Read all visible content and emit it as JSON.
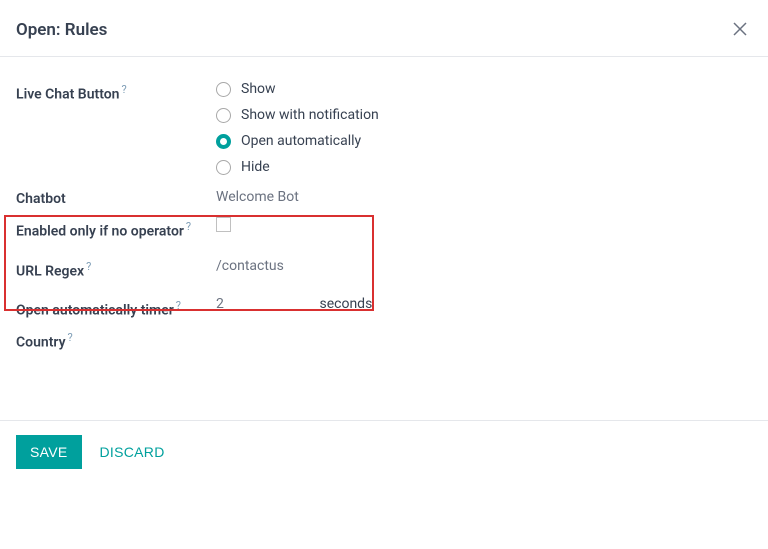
{
  "header": {
    "title": "Open: Rules"
  },
  "labels": {
    "live_chat_button": "Live Chat Button",
    "chatbot": "Chatbot",
    "enabled_only_if_no_operator": "Enabled only if no operator",
    "url_regex": "URL Regex",
    "open_automatically_timer": "Open automatically timer",
    "country": "Country",
    "help": "?"
  },
  "radio_options": {
    "show": "Show",
    "show_with_notification": "Show with notification",
    "open_automatically": "Open automatically",
    "hide": "Hide"
  },
  "values": {
    "chatbot": "Welcome Bot",
    "url_regex": "/contactus",
    "timer_value": "2",
    "timer_unit": "seconds"
  },
  "buttons": {
    "save": "SAVE",
    "discard": "DISCARD"
  }
}
